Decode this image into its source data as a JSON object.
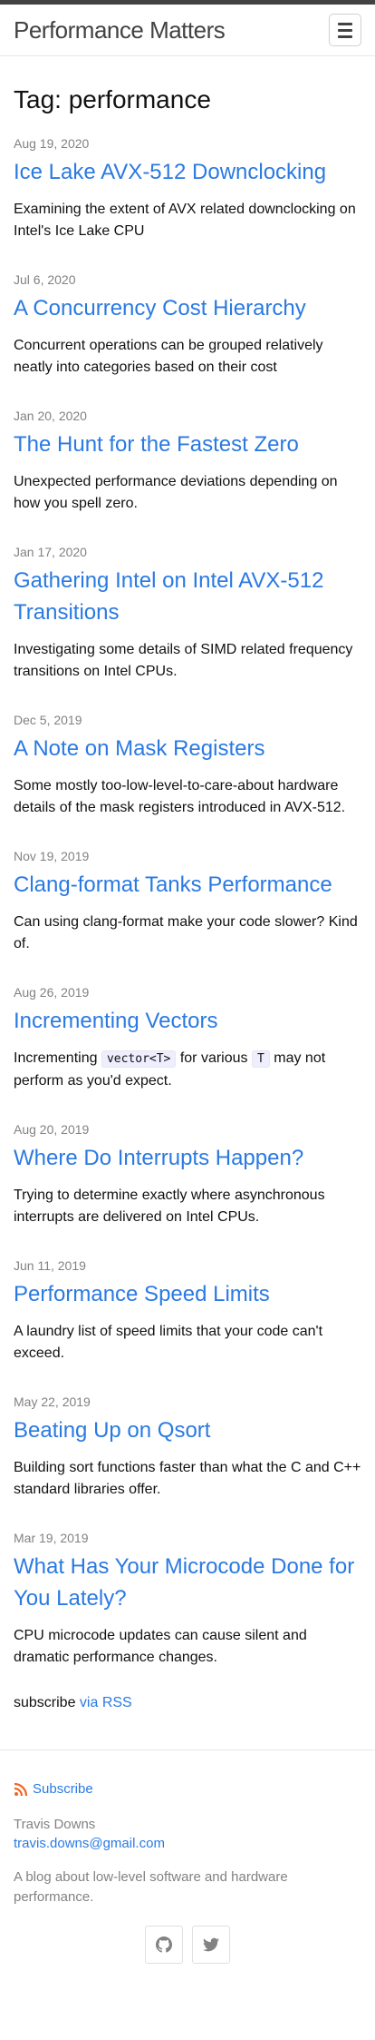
{
  "site": {
    "title": "Performance Matters"
  },
  "page": {
    "heading": "Tag: performance"
  },
  "posts": [
    {
      "date": "Aug 19, 2020",
      "title": "Ice Lake AVX-512 Downclocking",
      "excerpt": "Examining the extent of AVX related downclocking on Intel's Ice Lake CPU"
    },
    {
      "date": "Jul 6, 2020",
      "title": "A Concurrency Cost Hierarchy",
      "excerpt": "Concurrent operations can be grouped relatively neatly into categories based on their cost"
    },
    {
      "date": "Jan 20, 2020",
      "title": "The Hunt for the Fastest Zero",
      "excerpt": "Unexpected performance deviations depending on how you spell zero."
    },
    {
      "date": "Jan 17, 2020",
      "title": "Gathering Intel on Intel AVX-512 Transitions",
      "excerpt": "Investigating some details of SIMD related frequency transitions on Intel CPUs."
    },
    {
      "date": "Dec 5, 2019",
      "title": "A Note on Mask Registers",
      "excerpt": "Some mostly too-low-level-to-care-about hardware details of the mask registers introduced in AVX-512."
    },
    {
      "date": "Nov 19, 2019",
      "title": "Clang-format Tanks Performance",
      "excerpt": "Can using clang-format make your code slower? Kind of."
    },
    {
      "date": "Aug 26, 2019",
      "title": "Incrementing Vectors",
      "excerpt_before": "Incrementing ",
      "excerpt_code1": "vector<T>",
      "excerpt_middle": " for various ",
      "excerpt_code2": "T",
      "excerpt_after": " may not perform as you'd expect."
    },
    {
      "date": "Aug 20, 2019",
      "title": "Where Do Interrupts Happen?",
      "excerpt": "Trying to determine exactly where asynchronous interrupts are delivered on Intel CPUs."
    },
    {
      "date": "Jun 11, 2019",
      "title": "Performance Speed Limits",
      "excerpt": "A laundry list of speed limits that your code can't exceed."
    },
    {
      "date": "May 22, 2019",
      "title": "Beating Up on Qsort",
      "excerpt": "Building sort functions faster than what the C and C++ standard libraries offer."
    },
    {
      "date": "Mar 19, 2019",
      "title": "What Has Your Microcode Done for You Lately?",
      "excerpt": "CPU microcode updates can cause silent and dramatic performance changes."
    }
  ],
  "subscribe": {
    "text": "subscribe ",
    "link": "via RSS"
  },
  "footer": {
    "rss_label": "Subscribe",
    "author": "Travis Downs",
    "email": "travis.downs@gmail.com",
    "description": "A blog about low-level software and hardware performance.",
    "rss_icon": "rss-icon",
    "social": [
      "github-icon",
      "twitter-icon"
    ]
  },
  "colors": {
    "link": "#2a7ae2",
    "meta": "#828282",
    "topbar": "#424242",
    "rss": "#f26522"
  }
}
